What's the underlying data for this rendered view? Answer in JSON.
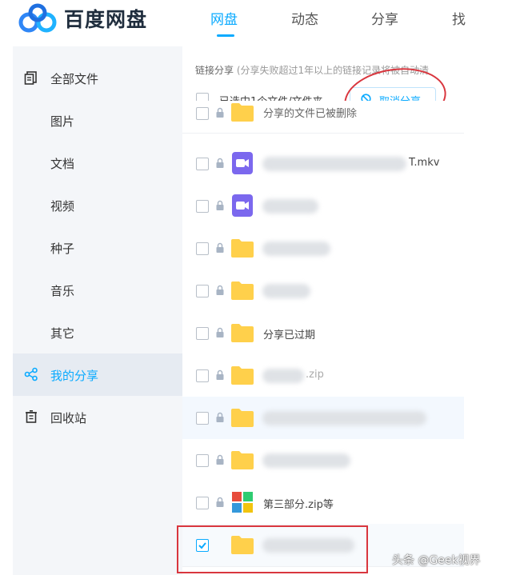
{
  "header": {
    "brand": "百度网盘",
    "nav": [
      {
        "label": "网盘",
        "active": true
      },
      {
        "label": "动态",
        "active": false
      },
      {
        "label": "分享",
        "active": false
      },
      {
        "label": "找",
        "active": false
      }
    ]
  },
  "sidebar": {
    "items": [
      {
        "label": "全部文件",
        "icon": "files-icon"
      },
      {
        "label": "图片"
      },
      {
        "label": "文档"
      },
      {
        "label": "视频"
      },
      {
        "label": "种子"
      },
      {
        "label": "音乐"
      },
      {
        "label": "其它"
      },
      {
        "label": "我的分享",
        "icon": "share-icon",
        "active": true
      },
      {
        "label": "回收站",
        "icon": "trash-icon"
      }
    ]
  },
  "main": {
    "title": "链接分享",
    "title_note": "(分享失败超过1年以上的链接记录将被自动清",
    "selection_text": "已选中1个文件/文件夹",
    "cancel_share_label": "取消分享",
    "files": [
      {
        "name": "分享的文件已被删除",
        "type": "folder",
        "icon": "folder-icon"
      },
      {
        "name": "T.mkv",
        "type": "video",
        "icon": "video-file-icon",
        "redacted": true
      },
      {
        "name": "",
        "type": "video",
        "icon": "video-file-icon",
        "redacted": true
      },
      {
        "name": "",
        "type": "folder",
        "icon": "folder-icon",
        "redacted": true
      },
      {
        "name": "",
        "type": "folder",
        "icon": "folder-icon",
        "redacted": true
      },
      {
        "name": "分享已过期",
        "type": "folder",
        "icon": "folder-icon"
      },
      {
        "name": ".zip",
        "type": "folder",
        "icon": "folder-icon",
        "redacted": true
      },
      {
        "name": "",
        "type": "folder",
        "icon": "folder-icon",
        "redacted": true
      },
      {
        "name": "",
        "type": "folder",
        "icon": "folder-icon",
        "redacted": true
      },
      {
        "name": "第三部分.zip等",
        "type": "archive",
        "icon": "multi-file-icon"
      },
      {
        "name": "",
        "type": "folder",
        "icon": "folder-icon",
        "redacted": true,
        "checked": true
      }
    ]
  },
  "watermark": "头条 @Geek视界",
  "colors": {
    "accent": "#09aaff",
    "annotation_red": "#d9363e",
    "folder": "#ffd04b",
    "video_icon": "#7b68ee"
  }
}
